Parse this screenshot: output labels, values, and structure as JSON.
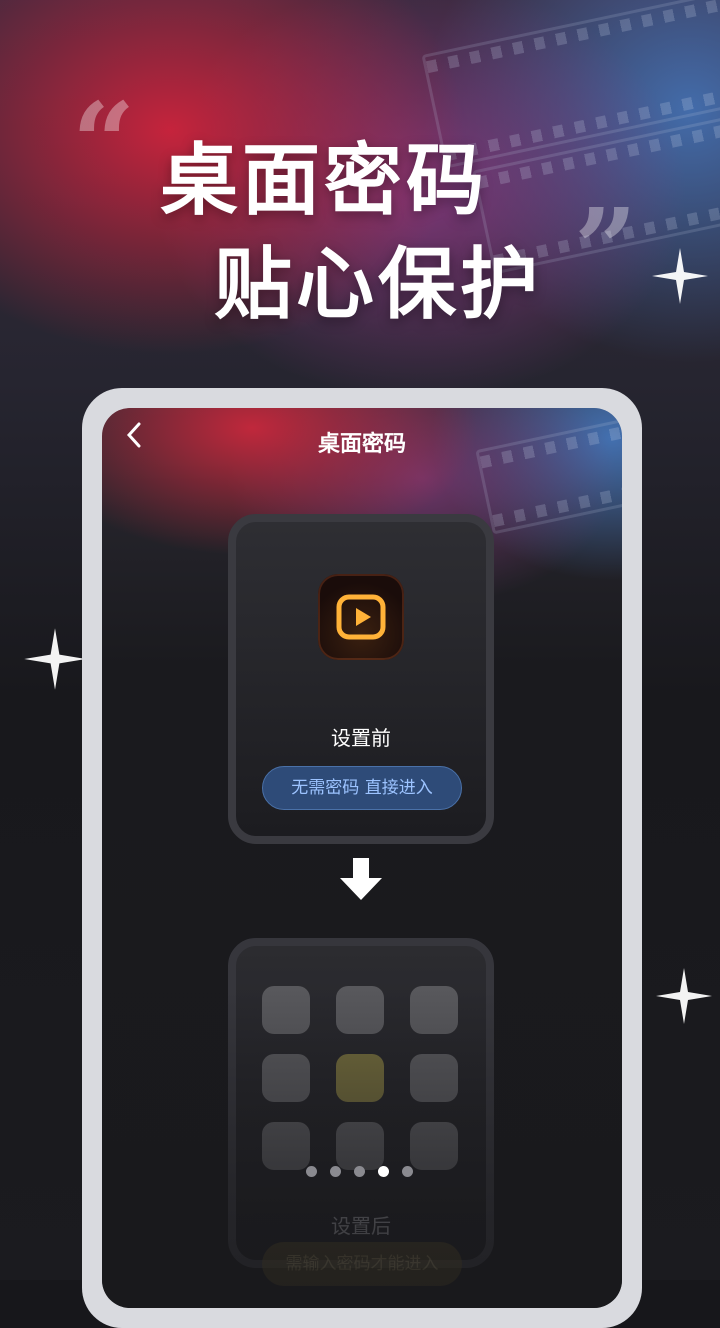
{
  "hero": {
    "line1": "桌面密码",
    "line2": "贴心保护",
    "quote_open": "“",
    "quote_close": "”"
  },
  "screen": {
    "back_icon": "chevron-left-icon",
    "title": "桌面密码"
  },
  "before": {
    "label": "设置前",
    "badge": "无需密码 直接进入"
  },
  "after": {
    "label": "设置后",
    "badge": "需输入密码才能进入"
  },
  "pager": {
    "total": 5,
    "active_index": 3
  },
  "colors": {
    "accent_blue": "#9cc3ff",
    "highlight_tile": "#7c7440"
  }
}
